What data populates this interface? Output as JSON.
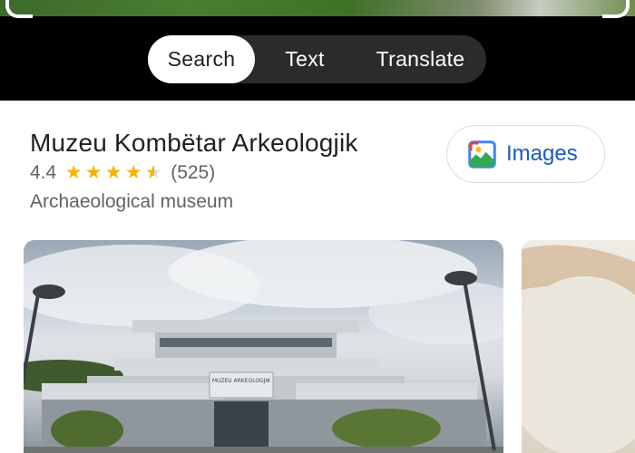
{
  "camera_modes": {
    "search": "Search",
    "text": "Text",
    "translate": "Translate"
  },
  "place": {
    "name": "Muzeu Kombëtar Arkeologjik",
    "rating": "4.4",
    "rating_value": 4.4,
    "review_count": "(525)",
    "category": "Archaeological museum"
  },
  "images_button": {
    "label": "Images",
    "icon": "image-icon"
  },
  "photos": {
    "main_sign_text": "MUZEU ARKEOLOGJIK"
  },
  "colors": {
    "star": "#f4b400",
    "link_blue": "#1a5bc4",
    "active_chip_bg": "#ffffff",
    "chip_bar_bg": "#2b2b2b"
  }
}
